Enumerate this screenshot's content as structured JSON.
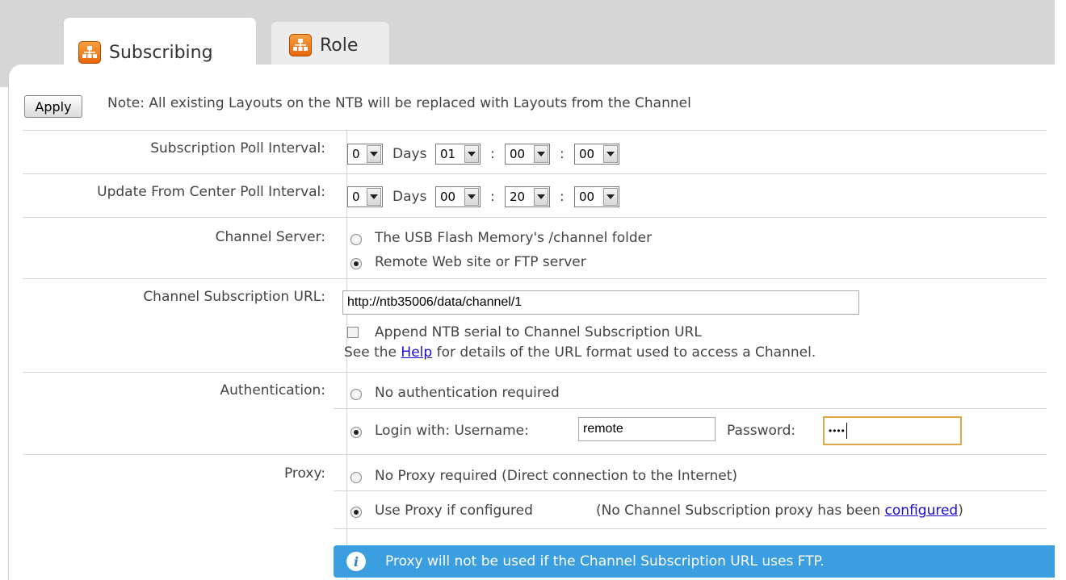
{
  "tabs": [
    {
      "label": "Subscribing",
      "icon": "network-icon",
      "active": true
    },
    {
      "label": "Role",
      "icon": "network-icon",
      "active": false
    }
  ],
  "toolbar": {
    "apply_label": "Apply",
    "note": "Note: All existing Layouts on the NTB will be replaced with Layouts from the Channel"
  },
  "subscription_poll": {
    "label": "Subscription Poll Interval:",
    "days": "0",
    "days_label": "Days",
    "hours": "01",
    "minutes": "00",
    "seconds": "00",
    "sep": ":"
  },
  "update_poll": {
    "label": "Update From Center Poll Interval:",
    "days": "0",
    "days_label": "Days",
    "hours": "00",
    "minutes": "20",
    "seconds": "00",
    "sep": ":"
  },
  "channel_server": {
    "label": "Channel Server:",
    "options": [
      {
        "label": "The USB Flash Memory's /channel folder",
        "selected": false
      },
      {
        "label": "Remote Web site or FTP server",
        "selected": true
      }
    ]
  },
  "subscription_url": {
    "label": "Channel Subscription URL:",
    "value": "http://ntb35006/data/channel/1",
    "append_label": "Append NTB serial to Channel Subscription URL",
    "append_checked": false,
    "help_prefix": "See the",
    "help_link": "Help",
    "help_suffix": "for details of the URL format used to access a Channel."
  },
  "authentication": {
    "label": "Authentication:",
    "none_label": "No authentication required",
    "login_label": "Login with: Username:",
    "username": "remote",
    "password_label": "Password:",
    "password_mask": "••••",
    "selected": "login"
  },
  "proxy": {
    "label": "Proxy:",
    "none_label": "No Proxy required (Direct connection to the Internet)",
    "use_label": "Use Proxy if configured",
    "use_note_prefix": "(No Channel Subscription proxy has been",
    "use_note_link": "configured",
    "use_note_suffix": ")",
    "selected": "use",
    "info": "Proxy will not be used if the Channel Subscription URL uses FTP."
  },
  "colors": {
    "tab_icon": "#e8650a",
    "info_bar": "#3a9ee0",
    "link": "#1a0dcc",
    "focus_border": "#e2a64a"
  }
}
